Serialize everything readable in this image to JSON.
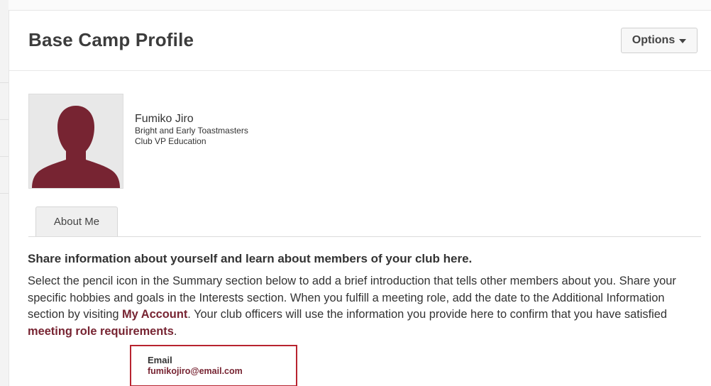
{
  "header": {
    "title": "Base Camp Profile",
    "options_label": "Options"
  },
  "profile": {
    "name": "Fumiko Jiro",
    "club": "Bright and Early Toastmasters",
    "role": "Club VP Education",
    "avatar_color": "#772432"
  },
  "tabs": [
    {
      "label": "About Me"
    }
  ],
  "intro": {
    "heading": "Share information about yourself and learn about members of your club here.",
    "text_1": "Select the pencil icon in the Summary section below to add a brief introduction that tells other members about you. Share your specific hobbies and goals in the Interests section. When you fulfill a meeting role, add the date to the Additional Information section by visiting ",
    "link_my_account": "My Account",
    "text_2": ". Your club officers will use the information you provide here to confirm that you have satisfied ",
    "link_requirements": "meeting role requirements",
    "text_3": "."
  },
  "email": {
    "label": "Email",
    "value": "fumikojiro@email.com"
  },
  "colors": {
    "accent": "#772432",
    "highlight_border": "#b8232f"
  },
  "icons": {
    "options_caret": "caret-down-icon",
    "avatar": "person-silhouette-icon"
  }
}
